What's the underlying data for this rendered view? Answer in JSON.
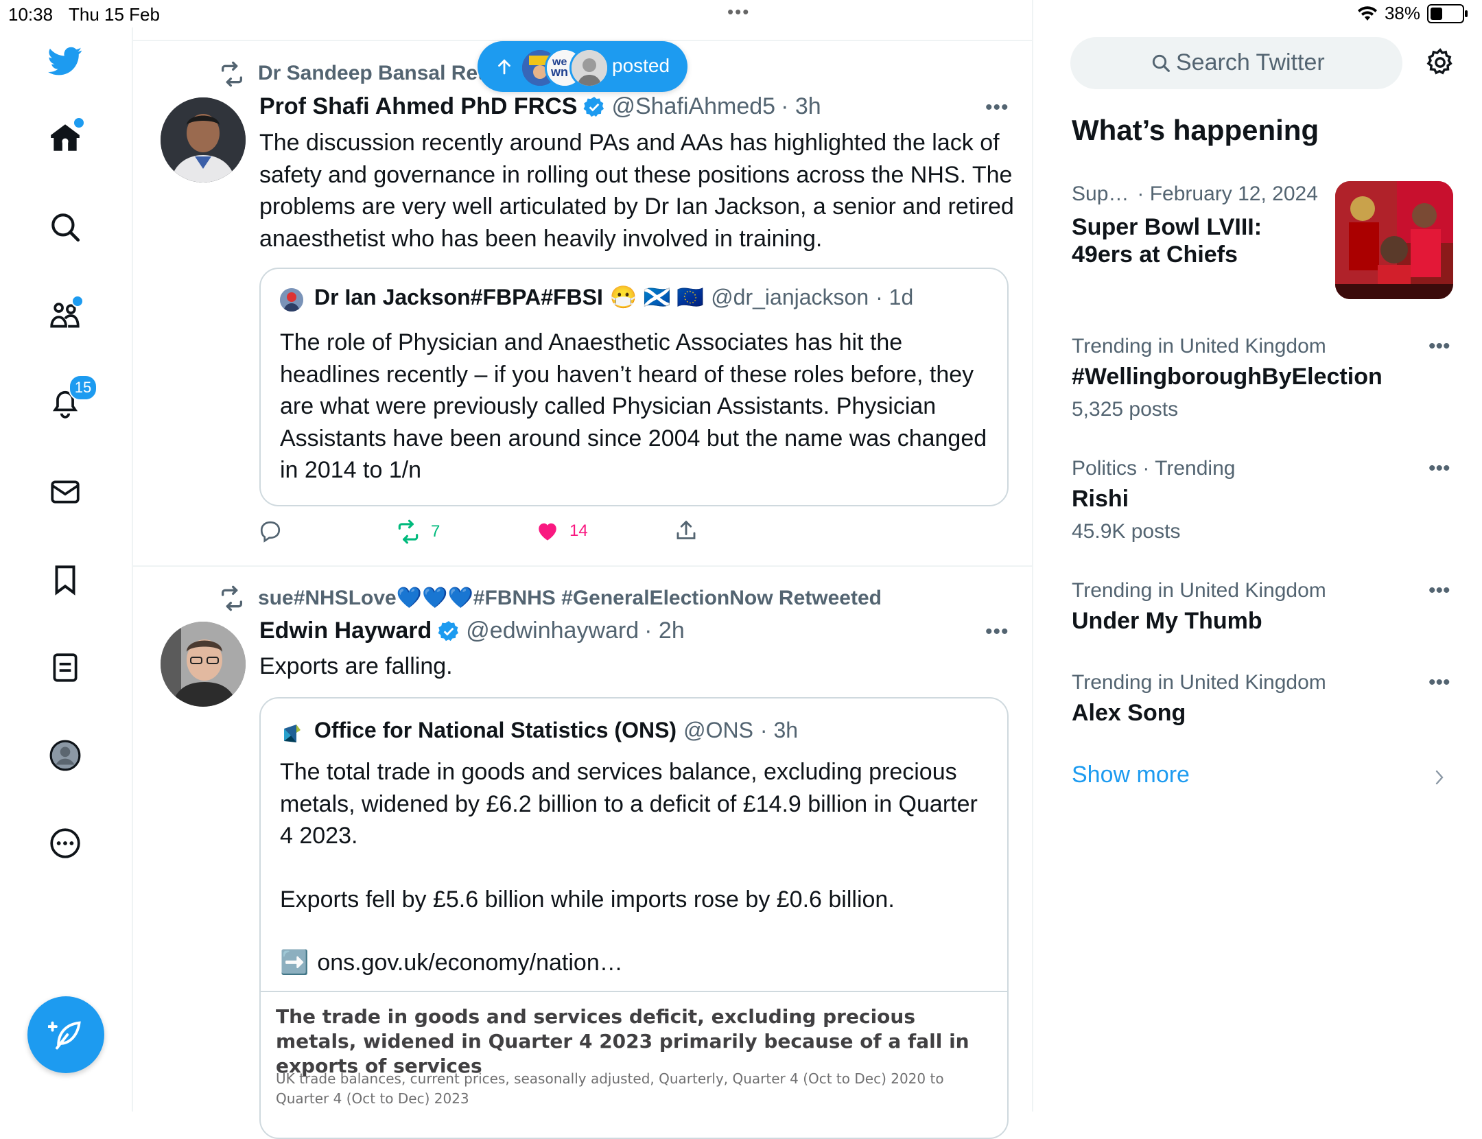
{
  "status_bar": {
    "time": "10:38",
    "date": "Thu 15 Feb",
    "multitask_dots": "•••",
    "battery_percent": "38%",
    "battery_level": 0.38
  },
  "nav": {
    "items": [
      {
        "icon": "twitter-bird-icon"
      },
      {
        "icon": "home-icon",
        "dot": true
      },
      {
        "icon": "search-icon"
      },
      {
        "icon": "communities-icon",
        "dot": true
      },
      {
        "icon": "notifications-bell-icon",
        "badge": "15"
      },
      {
        "icon": "messages-envelope-icon"
      },
      {
        "icon": "bookmark-icon"
      },
      {
        "icon": "lists-icon"
      },
      {
        "icon": "profile-avatar-icon"
      },
      {
        "icon": "more-circle-icon"
      }
    ],
    "compose_icon": "compose-feather-icon"
  },
  "posted_pill": {
    "label": "posted",
    "icon": "arrow-up-icon"
  },
  "tweets": [
    {
      "retweeted_by": "Dr Sandeep Bansal Ret",
      "name": "Prof Shafi Ahmed PhD FRCS",
      "handle": "@ShafiAhmed5",
      "time": "· 3h",
      "text": "The discussion recently around PAs and AAs has highlighted the lack of safety and governance in rolling out these positions across the NHS. The problems are very well articulated by Dr Ian Jackson, a senior and retired anaesthetist who has been heavily involved in training.",
      "quote": {
        "name": "Dr Ian Jackson#FBPA#FBSI",
        "emoji": "😷 🏴󠁧󠁢󠁳󠁣󠁴󠁿 🇪🇺",
        "handle": "@dr_ianjackson",
        "time": "· 1d",
        "text": "The role of Physician and Anaesthetic Associates has hit the headlines recently – if you haven’t heard of these roles before, they are what were previously called Physician Assistants. Physician Assistants have been around since 2004 but the name was changed in 2014 to 1/n"
      },
      "actions": {
        "reply": "",
        "retweets": "7",
        "likes": "14",
        "share": ""
      }
    },
    {
      "retweeted_by": "sue#NHSLove💙💙💙#FBNHS #GeneralElectionNow Retweeted",
      "name": "Edwin Hayward",
      "handle": "@edwinhayward",
      "time": "· 2h",
      "text": "Exports are falling.",
      "quote": {
        "name": "Office for National Statistics (ONS)",
        "handle": "@ONS",
        "time": "· 3h",
        "text_p1": "The total trade in goods and services balance, excluding precious metals, widened by £6.2 billion to a deficit of £14.9 billion in Quarter 4 2023.",
        "text_p2": "Exports fell by £5.6 billion while imports rose by £0.6 billion.",
        "link_emoji": "➡️",
        "link": "ons.gov.uk/economy/nation…",
        "card_title": "The trade in goods and services deficit, excluding precious metals, widened in Quarter 4 2023 primarily because of a fall in exports of services",
        "card_subtitle": "UK trade balances, current prices, seasonally adjusted, Quarterly, Quarter 4 (Oct to Dec) 2020 to Quarter 4 (Oct to Dec) 2023"
      }
    }
  ],
  "sidebar": {
    "search_placeholder": "Search Twitter",
    "settings_icon": "gear-icon",
    "heading": "What’s happening",
    "featured": {
      "category": "Sup…",
      "date": "· February 12, 2024",
      "title_line1": "Super Bowl LVIII:",
      "title_line2": "49ers at Chiefs"
    },
    "trends": [
      {
        "meta": "Trending in United Kingdom",
        "title": "#WellingboroughByElection",
        "count": "5,325 posts"
      },
      {
        "meta": "Politics · Trending",
        "title": "Rishi",
        "count": "45.9K posts"
      },
      {
        "meta": "Trending in United Kingdom",
        "title": "Under My Thumb",
        "count": ""
      },
      {
        "meta": "Trending in United Kingdom",
        "title": "Alex Song",
        "count": ""
      }
    ],
    "show_more": "Show more",
    "more_dots": "•••"
  },
  "colors": {
    "accent": "#1d9bf0",
    "text_primary": "#0f1419",
    "text_secondary": "#536471",
    "retweet_green": "#00ba7c",
    "like_pink": "#f91880",
    "border": "#cfd9de"
  }
}
